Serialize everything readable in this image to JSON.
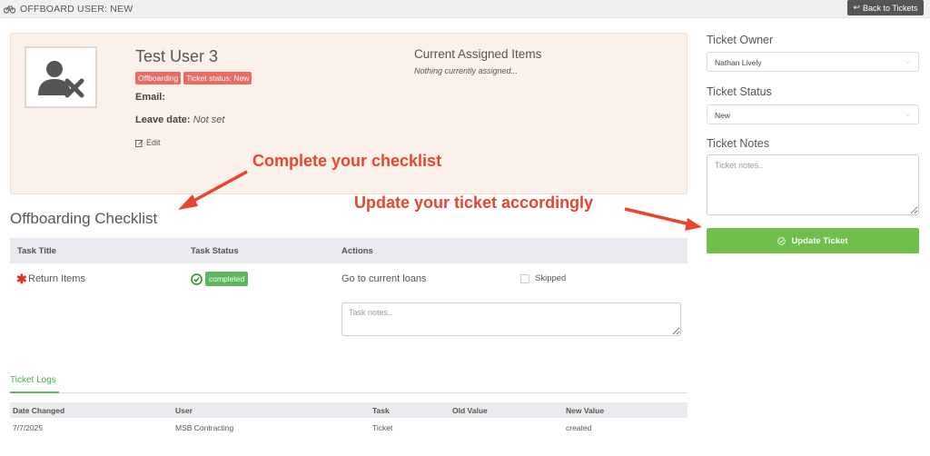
{
  "topbar": {
    "logo_icon": "bicycle-icon",
    "title": "OFFBOARD USER: NEW",
    "back_label": "Back to Tickets",
    "back_icon": "reply-arrow-icon"
  },
  "user": {
    "avatar_icon": "user-remove-icon",
    "name": "Test User 3",
    "badges": [
      "Offboarding",
      "Ticket status: New"
    ],
    "email_label": "Email:",
    "leave_label": "Leave date:",
    "leave_value": "Not set",
    "edit_label": "Edit",
    "edit_icon": "edit-icon"
  },
  "assigned": {
    "title": "Current Assigned Items",
    "empty_text": "Nothing currently assigned..."
  },
  "annotations": {
    "checklist_hint": "Complete your checklist",
    "ticket_hint": "Update your ticket accordingly",
    "color": "#e8452f"
  },
  "checklist": {
    "title": "Offboarding Checklist",
    "columns": [
      "Task Title",
      "Task Status",
      "Actions"
    ],
    "tasks": [
      {
        "required_icon": "asterisk-icon",
        "title": "Return Items",
        "status_icon": "check-circle-icon",
        "status": "completed",
        "action_link": "Go to current loans",
        "skipped_label": "Skipped",
        "notes_placeholder": "Task notes.."
      }
    ]
  },
  "logs": {
    "tab_label": "Ticket Logs",
    "columns": [
      "Date Changed",
      "User",
      "Task",
      "Old Value",
      "New Value"
    ],
    "rows": [
      [
        "7/7/2025",
        "MSB Contracting",
        "Ticket",
        "",
        "created"
      ]
    ]
  },
  "ticket": {
    "owner_label": "Ticket Owner",
    "owner_value": "Nathan Lively",
    "status_label": "Ticket Status",
    "status_value": "New",
    "notes_label": "Ticket Notes",
    "notes_placeholder": "Ticket notes..",
    "update_label": "Update Ticket",
    "update_icon": "check-circle-outline-icon"
  },
  "colors": {
    "accent_green": "#70bf4c",
    "badge_red": "#e96b62",
    "card_bg": "#fcf1ea"
  }
}
